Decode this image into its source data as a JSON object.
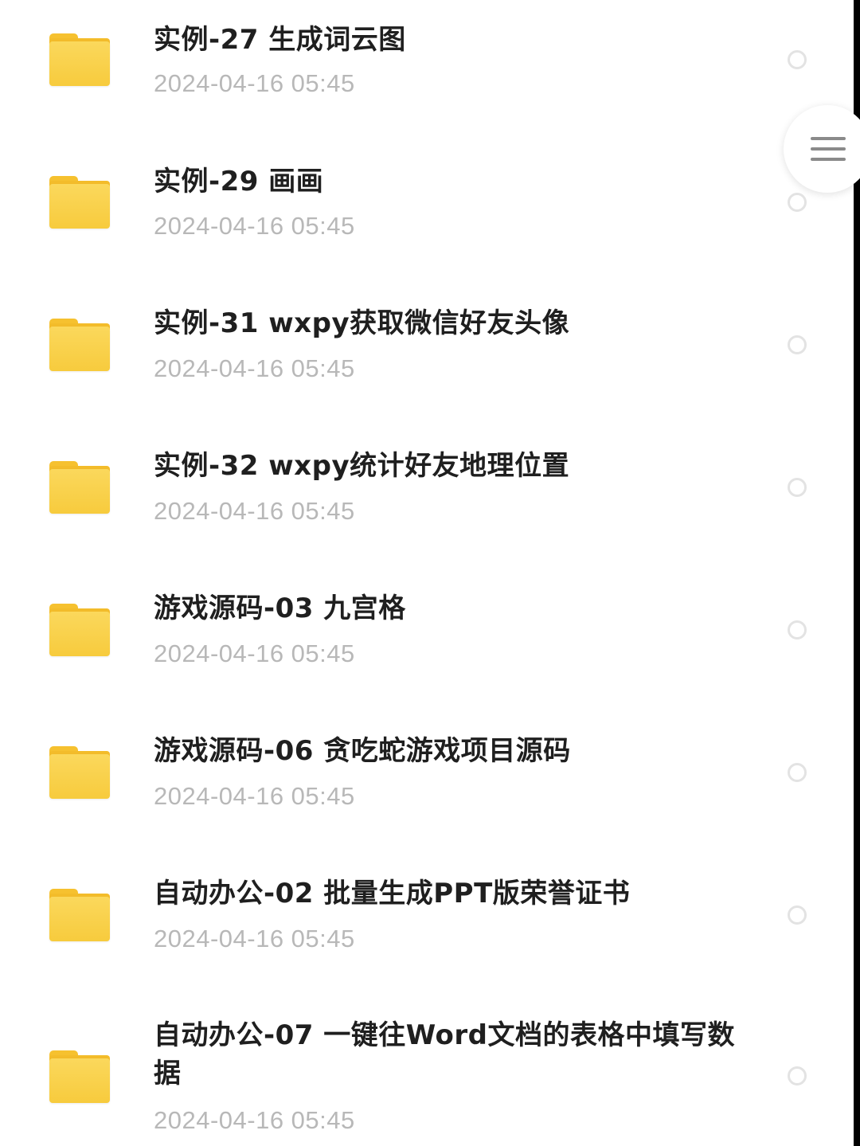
{
  "files": [
    {
      "name": "实例-27 生成词云图",
      "date": "2024-04-16  05:45"
    },
    {
      "name": "实例-29 画画",
      "date": "2024-04-16  05:45"
    },
    {
      "name": "实例-31 wxpy获取微信好友头像",
      "date": "2024-04-16  05:45"
    },
    {
      "name": "实例-32 wxpy统计好友地理位置",
      "date": "2024-04-16  05:45"
    },
    {
      "name": "游戏源码-03 九宫格",
      "date": "2024-04-16  05:45"
    },
    {
      "name": "游戏源码-06 贪吃蛇游戏项目源码",
      "date": "2024-04-16  05:45"
    },
    {
      "name": "自动办公-02 批量生成PPT版荣誉证书",
      "date": "2024-04-16  05:45"
    },
    {
      "name": "自动办公-07 一键往Word文档的表格中填写数据",
      "date": "2024-04-16  05:45"
    }
  ],
  "icons": {
    "folder": "folder-icon",
    "select": "radio-circle-icon",
    "menu": "hamburger-menu-icon"
  },
  "colors": {
    "folder": "#f9cf45",
    "date_text": "#b8b8b8",
    "title_text": "#1f1f1f"
  }
}
